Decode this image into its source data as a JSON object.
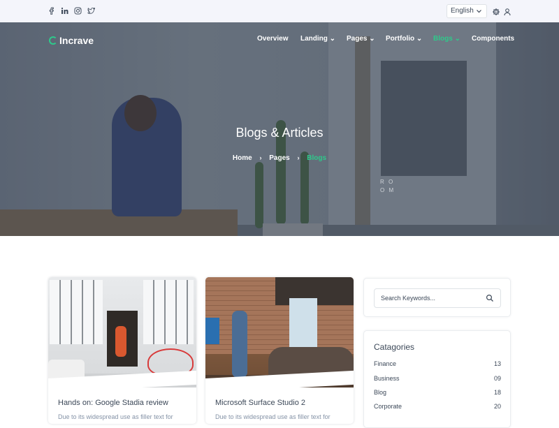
{
  "topbar": {
    "social_icons": [
      "facebook-icon",
      "linkedin-icon",
      "instagram-icon",
      "twitter-icon"
    ],
    "language": "English",
    "icons": [
      "settings-icon",
      "user-icon"
    ]
  },
  "brand": {
    "name": "Incrave",
    "accent": "#2eca8b"
  },
  "nav": {
    "items": [
      {
        "label": "Overview",
        "dropdown": false,
        "active": false
      },
      {
        "label": "Landing",
        "dropdown": true,
        "active": false
      },
      {
        "label": "Pages",
        "dropdown": true,
        "active": false
      },
      {
        "label": "Portfolio",
        "dropdown": true,
        "active": false
      },
      {
        "label": "Blogs",
        "dropdown": true,
        "active": true
      },
      {
        "label": "Components",
        "dropdown": false,
        "active": false
      }
    ]
  },
  "hero": {
    "title": "Blogs & Articles",
    "room_letters": [
      "R O",
      "O M"
    ],
    "breadcrumb": [
      "Home",
      "Pages",
      "Blogs"
    ]
  },
  "posts": [
    {
      "title": "Hands on: Google Stadia review",
      "excerpt": "Due to its widespread use as filler text for"
    },
    {
      "title": "Microsoft Surface Studio 2",
      "excerpt": "Due to its widespread use as filler text for"
    }
  ],
  "sidebar": {
    "search_placeholder": "Search Keywords...",
    "categories_title": "Catagories",
    "categories": [
      {
        "name": "Finance",
        "count": "13"
      },
      {
        "name": "Business",
        "count": "09"
      },
      {
        "name": "Blog",
        "count": "18"
      },
      {
        "name": "Corporate",
        "count": "20"
      }
    ]
  }
}
